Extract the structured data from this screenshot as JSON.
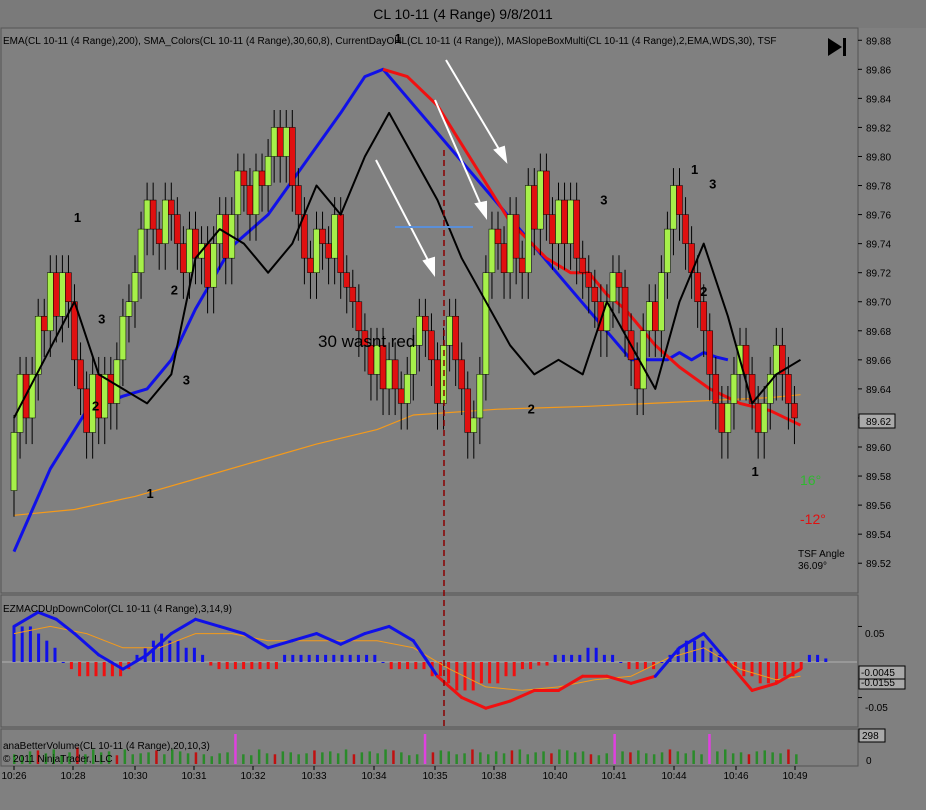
{
  "window_title": "CL 10-11 (4 Range)  9/8/2011",
  "price_panel": {
    "indicator_caption": "EMA(CL 10-11 (4 Range),200), SMA_Colors(CL 10-11 (4 Range),30,60,8), CurrentDayOHL(CL 10-11 (4 Range)), MASlopeBoxMulti(CL 10-11 (4 Range),2,EMA,WDS,30), TSF",
    "annotation": "30 wasnt red",
    "angle_up": "16°",
    "angle_down": "-12°",
    "tsf_label": "TSF Angle",
    "tsf_value": "36.09°",
    "last_price": "89.62",
    "swing_labels": [
      {
        "text": "1",
        "x": 10.5,
        "y": 89.755
      },
      {
        "text": "3",
        "x": 14.5,
        "y": 89.685
      },
      {
        "text": "2",
        "x": 13.5,
        "y": 89.625
      },
      {
        "text": "2",
        "x": 26.5,
        "y": 89.705
      },
      {
        "text": "3",
        "x": 28.5,
        "y": 89.643
      },
      {
        "text": "1",
        "x": 22.5,
        "y": 89.565
      },
      {
        "text": "1",
        "x": 63.5,
        "y": 89.878
      },
      {
        "text": "3",
        "x": 97.5,
        "y": 89.767
      },
      {
        "text": "2",
        "x": 85.5,
        "y": 89.623
      },
      {
        "text": "1",
        "x": 112.5,
        "y": 89.788
      },
      {
        "text": "3",
        "x": 115.5,
        "y": 89.778
      },
      {
        "text": "2",
        "x": 114,
        "y": 89.704
      },
      {
        "text": "1",
        "x": 122.5,
        "y": 89.58
      }
    ]
  },
  "macd_panel": {
    "caption": "EZMACDUpDownColor(CL 10-11 (4 Range),3,14,9)",
    "tick_labels": [
      "0.05",
      "-0.05"
    ],
    "value_box_1": "-0.0045",
    "value_box_2": "-0.0155"
  },
  "volume_panel": {
    "caption": "anaBetterVolume(CL 10-11 (4 Range),20,10,3)",
    "copyright": "© 2011 NinjaTrader, LLC",
    "value_box": "298",
    "zero_label": "0"
  },
  "time_labels": [
    "10:26",
    "10:28",
    "10:30",
    "10:31",
    "10:32",
    "10:33",
    "10:34",
    "10:35",
    "10:38",
    "10:40",
    "10:41",
    "10:44",
    "10:46",
    "10:49"
  ],
  "colors": {
    "background": "#808080",
    "up_bar": "#a6f04a",
    "down_bar": "#e01010",
    "ema200": "#f59a1a",
    "sma30": "#1010e8",
    "sma60": "#f01010",
    "macd_positive": "#1010e8",
    "macd_negative": "#f01010",
    "session_line": "#8b0000"
  },
  "chart_data": {
    "type": "candlestick",
    "title": "CL 10-11 (4 Range)  9/8/2011",
    "y_ticks": [
      89.52,
      89.54,
      89.56,
      89.58,
      89.6,
      89.62,
      89.64,
      89.66,
      89.68,
      89.7,
      89.72,
      89.74,
      89.76,
      89.78,
      89.8,
      89.82,
      89.84,
      89.86,
      89.88
    ],
    "ylim": [
      89.505,
      89.885
    ],
    "bars_close": [
      89.61,
      89.65,
      89.62,
      89.65,
      89.69,
      89.68,
      89.72,
      89.69,
      89.72,
      89.7,
      89.66,
      89.64,
      89.61,
      89.65,
      89.62,
      89.65,
      89.63,
      89.66,
      89.69,
      89.7,
      89.72,
      89.75,
      89.77,
      89.75,
      89.74,
      89.77,
      89.76,
      89.74,
      89.72,
      89.75,
      89.73,
      89.74,
      89.71,
      89.74,
      89.76,
      89.73,
      89.76,
      89.79,
      89.78,
      89.76,
      89.79,
      89.78,
      89.8,
      89.82,
      89.8,
      89.82,
      89.78,
      89.76,
      89.73,
      89.72,
      89.75,
      89.74,
      89.73,
      89.76,
      89.72,
      89.71,
      89.7,
      89.68,
      89.67,
      89.65,
      89.67,
      89.64,
      89.66,
      89.64,
      89.63,
      89.65,
      89.67,
      89.69,
      89.68,
      89.66,
      89.63,
      89.67,
      89.69,
      89.66,
      89.64,
      89.61,
      89.62,
      89.65,
      89.72,
      89.75,
      89.74,
      89.72,
      89.76,
      89.73,
      89.72,
      89.78,
      89.75,
      89.79,
      89.76,
      89.74,
      89.77,
      89.74,
      89.77,
      89.73,
      89.72,
      89.71,
      89.7,
      89.68,
      89.7,
      89.72,
      89.71,
      89.68,
      89.66,
      89.64,
      89.68,
      89.7,
      89.68,
      89.72,
      89.75,
      89.78,
      89.76,
      89.74,
      89.72,
      89.7,
      89.68,
      89.65,
      89.63,
      89.61,
      89.63,
      89.65,
      89.67,
      89.65,
      89.63,
      89.61,
      89.63,
      89.65,
      89.67,
      89.65,
      89.63,
      89.62
    ],
    "ema200": [
      [
        0,
        89.553
      ],
      [
        10,
        89.557
      ],
      [
        20,
        89.566
      ],
      [
        30,
        89.578
      ],
      [
        40,
        89.59
      ],
      [
        50,
        89.602
      ],
      [
        60,
        89.612
      ],
      [
        66,
        89.622
      ],
      [
        80,
        89.626
      ],
      [
        95,
        89.628
      ],
      [
        110,
        89.631
      ],
      [
        125,
        89.634
      ],
      [
        130,
        89.636
      ]
    ],
    "sma30": [
      [
        0,
        89.528
      ],
      [
        6,
        89.585
      ],
      [
        12,
        89.625
      ],
      [
        18,
        89.635
      ],
      [
        22,
        89.64
      ],
      [
        26,
        89.66
      ],
      [
        30,
        89.695
      ],
      [
        36,
        89.738
      ],
      [
        42,
        89.76
      ],
      [
        48,
        89.795
      ],
      [
        54,
        89.83
      ],
      [
        58,
        89.855
      ],
      [
        61,
        89.86
      ],
      [
        102,
        89.66
      ],
      [
        108,
        89.66
      ],
      [
        110,
        89.665
      ],
      [
        112,
        89.66
      ],
      [
        114,
        89.665
      ],
      [
        116,
        89.662
      ],
      [
        118,
        89.66
      ]
    ],
    "sma60": [
      [
        61,
        89.86
      ],
      [
        65,
        89.855
      ],
      [
        70,
        89.835
      ],
      [
        76,
        89.795
      ],
      [
        82,
        89.755
      ],
      [
        88,
        89.73
      ],
      [
        92,
        89.72
      ],
      [
        95,
        89.72
      ],
      [
        98,
        89.705
      ],
      [
        101,
        89.695
      ],
      [
        106,
        89.67
      ],
      [
        110,
        89.655
      ],
      [
        115,
        89.64
      ],
      [
        120,
        89.63
      ],
      [
        125,
        89.625
      ],
      [
        130,
        89.615
      ]
    ],
    "sma8_trace": [
      [
        0,
        89.62
      ],
      [
        5,
        89.66
      ],
      [
        10,
        89.7
      ],
      [
        14,
        89.65
      ],
      [
        18,
        89.64
      ],
      [
        22,
        89.63
      ],
      [
        26,
        89.65
      ],
      [
        30,
        89.73
      ],
      [
        34,
        89.75
      ],
      [
        38,
        89.74
      ],
      [
        42,
        89.72
      ],
      [
        46,
        89.74
      ],
      [
        50,
        89.78
      ],
      [
        54,
        89.76
      ],
      [
        58,
        89.8
      ],
      [
        62,
        89.83
      ],
      [
        66,
        89.8
      ],
      [
        70,
        89.77
      ],
      [
        74,
        89.73
      ],
      [
        78,
        89.7
      ],
      [
        82,
        89.67
      ],
      [
        86,
        89.65
      ],
      [
        90,
        89.66
      ],
      [
        94,
        89.65
      ],
      [
        98,
        89.7
      ],
      [
        102,
        89.67
      ],
      [
        106,
        89.64
      ],
      [
        110,
        89.7
      ],
      [
        114,
        89.74
      ],
      [
        118,
        89.69
      ],
      [
        122,
        89.63
      ],
      [
        126,
        89.65
      ],
      [
        130,
        89.66
      ]
    ],
    "macd": {
      "ylim": [
        -0.09,
        0.09
      ],
      "histogram": [
        0.05,
        0.05,
        0.05,
        0.04,
        0.03,
        0.02,
        0,
        -0.01,
        -0.02,
        -0.02,
        -0.02,
        -0.02,
        -0.02,
        -0.02,
        -0.01,
        0.01,
        0.02,
        0.03,
        0.04,
        0.03,
        0.03,
        0.02,
        0.02,
        0.01,
        -0.005,
        -0.01,
        -0.01,
        -0.01,
        -0.01,
        -0.01,
        -0.01,
        -0.01,
        -0.01,
        0.01,
        0.01,
        0.01,
        0.01,
        0.01,
        0.01,
        0.01,
        0.01,
        0.01,
        0.01,
        0.01,
        0.01,
        0,
        -0.01,
        -0.01,
        -0.01,
        -0.01,
        -0.01,
        -0.02,
        -0.02,
        -0.03,
        -0.04,
        -0.04,
        -0.04,
        -0.03,
        -0.03,
        -0.03,
        -0.02,
        -0.02,
        -0.01,
        -0.01,
        -0.005,
        -0.005,
        0.01,
        0.01,
        0.01,
        0.01,
        0.02,
        0.02,
        0.01,
        0.01,
        0,
        -0.01,
        -0.01,
        -0.01,
        -0.01,
        0,
        0.01,
        0.02,
        0.03,
        0.03,
        0.03,
        0.02,
        0.01,
        0,
        -0.01,
        -0.02,
        -0.02,
        -0.03,
        -0.03,
        -0.03,
        -0.02,
        -0.02,
        -0.01,
        0.01,
        0.01,
        0.005
      ],
      "macd_line": [
        [
          0,
          0.05
        ],
        [
          4,
          0.07
        ],
        [
          7,
          0.06
        ],
        [
          10,
          0.04
        ],
        [
          14,
          0.01
        ],
        [
          18,
          -0.01
        ],
        [
          22,
          0.01
        ],
        [
          26,
          0.04
        ],
        [
          30,
          0.06
        ],
        [
          34,
          0.05
        ],
        [
          38,
          0.04
        ],
        [
          42,
          0.02
        ],
        [
          46,
          0.03
        ],
        [
          50,
          0.04
        ],
        [
          54,
          0.025
        ],
        [
          58,
          0.04
        ],
        [
          62,
          0.05
        ],
        [
          66,
          0.03
        ],
        [
          70,
          -0.02
        ],
        [
          74,
          -0.05
        ],
        [
          78,
          -0.065
        ],
        [
          82,
          -0.055
        ],
        [
          86,
          -0.04
        ],
        [
          90,
          -0.04
        ],
        [
          94,
          -0.02
        ],
        [
          98,
          -0.02
        ],
        [
          102,
          -0.03
        ],
        [
          106,
          -0.02
        ],
        [
          110,
          0.02
        ],
        [
          114,
          0.04
        ],
        [
          118,
          0
        ],
        [
          122,
          -0.04
        ],
        [
          126,
          -0.03
        ],
        [
          130,
          -0.01
        ]
      ],
      "signal_line": [
        [
          0,
          0.04
        ],
        [
          6,
          0.05
        ],
        [
          12,
          0.04
        ],
        [
          18,
          0.02
        ],
        [
          24,
          0.02
        ],
        [
          30,
          0.04
        ],
        [
          36,
          0.04
        ],
        [
          42,
          0.03
        ],
        [
          48,
          0.03
        ],
        [
          54,
          0.03
        ],
        [
          60,
          0.03
        ],
        [
          66,
          0.02
        ],
        [
          72,
          -0.01
        ],
        [
          78,
          -0.035
        ],
        [
          84,
          -0.04
        ],
        [
          90,
          -0.035
        ],
        [
          96,
          -0.025
        ],
        [
          102,
          -0.02
        ],
        [
          108,
          0.005
        ],
        [
          114,
          0.02
        ],
        [
          120,
          -0.01
        ],
        [
          126,
          -0.025
        ],
        [
          130,
          -0.02
        ]
      ]
    },
    "volume": {
      "values": [
        20,
        18,
        26,
        28,
        22,
        30,
        18,
        24,
        34,
        20,
        30,
        24,
        26,
        18,
        30,
        20,
        22,
        24,
        28,
        20,
        30,
        26,
        22,
        24,
        20,
        16,
        22,
        24,
        26,
        20,
        18,
        30,
        22,
        20,
        26,
        24,
        20,
        22,
        28,
        24,
        26,
        22,
        30,
        20,
        24,
        26,
        22,
        30,
        28,
        24,
        18,
        20,
        22,
        24,
        28,
        26,
        20,
        22,
        30,
        24,
        20,
        26,
        22,
        28,
        30,
        20,
        24,
        26,
        22,
        30,
        28,
        24,
        26,
        20,
        18,
        22,
        30,
        26,
        24,
        28,
        22,
        20,
        24,
        30,
        26,
        22,
        28,
        20,
        24,
        26,
        30,
        22,
        24,
        20,
        26,
        28,
        24,
        22,
        30,
        20
      ],
      "highlight_indices": [
        28,
        52,
        76,
        88,
        100
      ]
    }
  }
}
